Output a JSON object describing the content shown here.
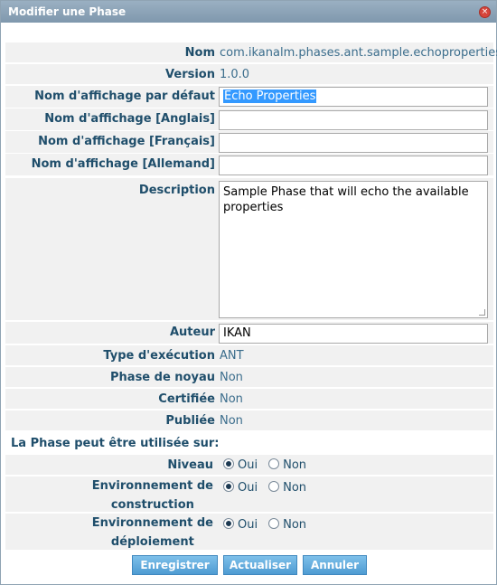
{
  "window": {
    "title": "Modifier une Phase"
  },
  "fields": {
    "nom": {
      "label": "Nom",
      "value": "com.ikanalm.phases.ant.sample.echoproperties"
    },
    "version": {
      "label": "Version",
      "value": "1.0.0"
    },
    "default_name": {
      "label": "Nom d'affichage par défaut",
      "value": "Echo Properties"
    },
    "name_en": {
      "label": "Nom d'affichage [Anglais]",
      "value": ""
    },
    "name_fr": {
      "label": "Nom d'affichage [Français]",
      "value": ""
    },
    "name_de": {
      "label": "Nom d'affichage [Allemand]",
      "value": ""
    },
    "description": {
      "label": "Description",
      "value": "Sample Phase that will echo the available properties"
    },
    "auteur": {
      "label": "Auteur",
      "value": "IKAN"
    },
    "exec_type": {
      "label": "Type d'exécution",
      "value": "ANT"
    },
    "core_phase": {
      "label": "Phase de noyau",
      "value": "Non"
    },
    "certified": {
      "label": "Certifiée",
      "value": "Non"
    },
    "published": {
      "label": "Publiée",
      "value": "Non"
    }
  },
  "usage": {
    "title": "La Phase peut être utilisée sur:",
    "niveau": {
      "label": "Niveau",
      "selected": "Oui"
    },
    "build_env": {
      "label_line1": "Environnement de",
      "label_line2": "construction",
      "selected": "Oui"
    },
    "deploy_env": {
      "label_line1": "Environnement de",
      "label_line2": "déploiement",
      "selected": "Oui"
    },
    "yes_label": "Oui",
    "no_label": "Non"
  },
  "buttons": {
    "save": "Enregistrer",
    "refresh": "Actualiser",
    "cancel": "Annuler"
  },
  "colors": {
    "title_bar": "#8aa2b6",
    "label_text": "#1f4e6b",
    "button": "#5aa8dc"
  }
}
